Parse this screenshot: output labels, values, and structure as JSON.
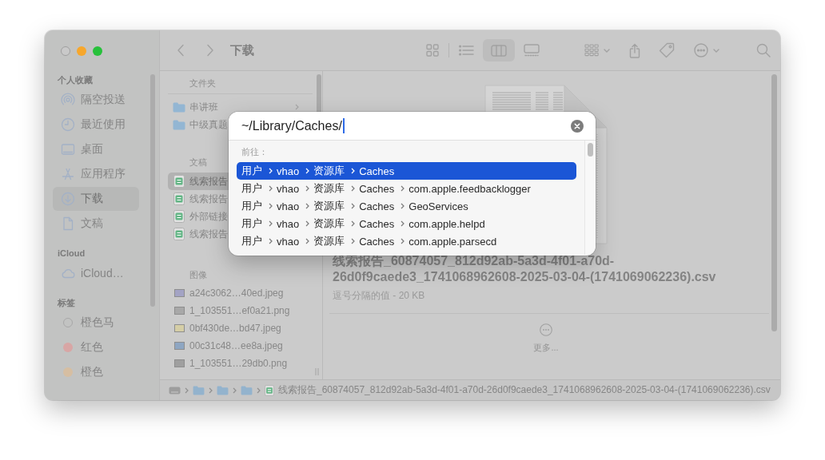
{
  "window": {
    "title": "下载"
  },
  "toolbar": {
    "view_buttons": [
      {
        "kind": "icons",
        "selected": false
      },
      {
        "kind": "list",
        "selected": false
      },
      {
        "kind": "columns",
        "selected": true
      },
      {
        "kind": "gallery",
        "selected": false
      }
    ]
  },
  "sidebar": {
    "sections": [
      {
        "heading": "个人收藏",
        "items": [
          {
            "label": "隔空投送",
            "kind": "airdrop",
            "selected": false
          },
          {
            "label": "最近使用",
            "kind": "recents",
            "selected": false
          },
          {
            "label": "桌面",
            "kind": "desktop",
            "selected": false
          },
          {
            "label": "应用程序",
            "kind": "applications",
            "selected": false
          },
          {
            "label": "下载",
            "kind": "downloads",
            "selected": true
          },
          {
            "label": "文稿",
            "kind": "documents",
            "selected": false
          }
        ]
      },
      {
        "heading": "iCloud",
        "items": [
          {
            "label": "iCloud…",
            "kind": "cloud",
            "selected": false
          }
        ]
      },
      {
        "heading": "标签",
        "items": [
          {
            "label": "橙色马",
            "kind": "tag",
            "selected": false
          },
          {
            "label": "红色",
            "kind": "tag",
            "color": "#d8a6a5",
            "selected": false
          },
          {
            "label": "橙色",
            "kind": "tag",
            "color": "#d6bea2",
            "selected": false
          }
        ]
      }
    ]
  },
  "browser_column": {
    "groups": [
      {
        "heading": "文件夹",
        "items": [
          {
            "name": "串讲班",
            "kind": "folder",
            "selected": false,
            "chevron": true
          },
          {
            "name": "中级真题",
            "kind": "folder",
            "selected": false
          }
        ]
      },
      {
        "heading": "文稿",
        "items": [
          {
            "name": "线索报告",
            "kind": "spreadsheet",
            "selected": true
          },
          {
            "name": "线索报告",
            "kind": "spreadsheet",
            "selected": false
          },
          {
            "name": "外部链接",
            "kind": "spreadsheet",
            "selected": false
          },
          {
            "name": "线索报告",
            "kind": "spreadsheet",
            "selected": false
          }
        ]
      },
      {
        "heading": "图像",
        "items": [
          {
            "name": "a24c3062…40ed.jpeg",
            "kind": "image",
            "color": "#a3a3c4",
            "selected": false
          },
          {
            "name": "1_103551…ef0a21.png",
            "kind": "image",
            "color": "#a8a8a8",
            "selected": false
          },
          {
            "name": "0bf430de…bd47.jpeg",
            "kind": "image",
            "color": "#d5cea6",
            "selected": false
          },
          {
            "name": "00c31c48…ee8a.jpeg",
            "kind": "image",
            "color": "#8ea6c2",
            "selected": false
          },
          {
            "name": "1_103551…29db0.png",
            "kind": "image",
            "color": "#9f9f9f",
            "selected": false
          }
        ]
      }
    ]
  },
  "preview": {
    "file_name": "线索报告_60874057_812d92ab-5a3d-4f01-a70d-26d0f9caede3_1741068962608-2025-03-04-(1741069062236).csv",
    "info": "逗号分隔的值 - 20 KB",
    "more_label": "更多..."
  },
  "path_bar": {
    "items": [
      {
        "kind": "disk"
      },
      {
        "kind": "folder"
      },
      {
        "kind": "folder"
      },
      {
        "kind": "folder"
      },
      {
        "kind": "spreadsheet",
        "label": "线索报告_60874057_812d92ab-5a3d-4f01-a70d-26d0f9caede3_1741068962608-2025-03-04-(1741069062236).csv"
      }
    ]
  },
  "go_to_folder": {
    "path": "~/Library/Caches/",
    "section_label": "前往：",
    "suggestions": [
      {
        "segments": [
          "用户",
          "vhao",
          "资源库",
          "Caches"
        ],
        "selected": true
      },
      {
        "segments": [
          "用户",
          "vhao",
          "资源库",
          "Caches",
          "com.apple.feedbacklogger"
        ],
        "selected": false
      },
      {
        "segments": [
          "用户",
          "vhao",
          "资源库",
          "Caches",
          "GeoServices"
        ],
        "selected": false
      },
      {
        "segments": [
          "用户",
          "vhao",
          "资源库",
          "Caches",
          "com.apple.helpd"
        ],
        "selected": false
      },
      {
        "segments": [
          "用户",
          "vhao",
          "资源库",
          "Caches",
          "com.apple.parsecd"
        ],
        "selected": false
      }
    ]
  }
}
